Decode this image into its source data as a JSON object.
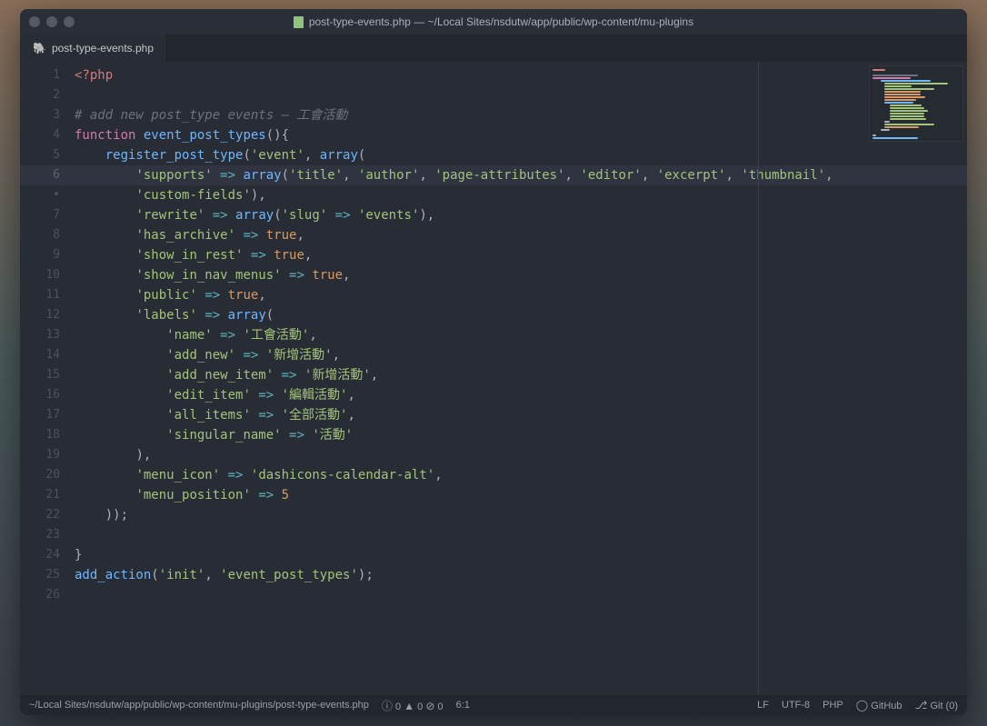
{
  "window": {
    "title": "post-type-events.php — ~/Local Sites/nsdutw/app/public/wp-content/mu-plugins"
  },
  "tab": {
    "label": "post-type-events.php"
  },
  "gutter": [
    "1",
    "2",
    "3",
    "4",
    "5",
    "6",
    "•",
    "7",
    "8",
    "9",
    "10",
    "11",
    "12",
    "13",
    "14",
    "15",
    "16",
    "17",
    "18",
    "19",
    "20",
    "21",
    "22",
    "23",
    "24",
    "25",
    "26"
  ],
  "code": {
    "l1_open": "<?php",
    "l3_comment": "# add new post_type events – 工會活動",
    "kw_function": "function",
    "fn_name": "event_post_types",
    "call_register": "register_post_type",
    "str_event": "'event'",
    "kw_array": "array",
    "str_supports": "'supports'",
    "arrow": "=>",
    "str_title": "'title'",
    "str_author": "'author'",
    "str_pageattr": "'page-attributes'",
    "str_editor": "'editor'",
    "str_excerpt": "'excerpt'",
    "str_thumbnail": "'thumbnail'",
    "str_customfields": "'custom-fields'",
    "str_rewrite": "'rewrite'",
    "str_slug": "'slug'",
    "str_events": "'events'",
    "str_hasarchive": "'has_archive'",
    "bool_true": "true",
    "str_showinrest": "'show_in_rest'",
    "str_showinmenus": "'show_in_nav_menus'",
    "str_public": "'public'",
    "str_labels": "'labels'",
    "str_name": "'name'",
    "str_name_v": "'工會活動'",
    "str_addnew": "'add_new'",
    "str_addnew_v": "'新增活動'",
    "str_addnewitem": "'add_new_item'",
    "str_addnewitem_v": "'新增活動'",
    "str_edititem": "'edit_item'",
    "str_edititem_v": "'編輯活動'",
    "str_allitems": "'all_items'",
    "str_allitems_v": "'全部活動'",
    "str_singular": "'singular_name'",
    "str_singular_v": "'活動'",
    "str_menuicon": "'menu_icon'",
    "str_menuicon_v": "'dashicons-calendar-alt'",
    "str_menupos": "'menu_position'",
    "num_5": "5",
    "call_addaction": "add_action",
    "str_init": "'init'",
    "str_cb": "'event_post_types'"
  },
  "status": {
    "path": "~/Local Sites/nsdutw/app/public/wp-content/mu-plugins/post-type-events.php",
    "diag": "0",
    "cursor": "6:1",
    "lf": "LF",
    "enc": "UTF-8",
    "lang": "PHP",
    "github": "GitHub",
    "git": "Git (0)"
  }
}
